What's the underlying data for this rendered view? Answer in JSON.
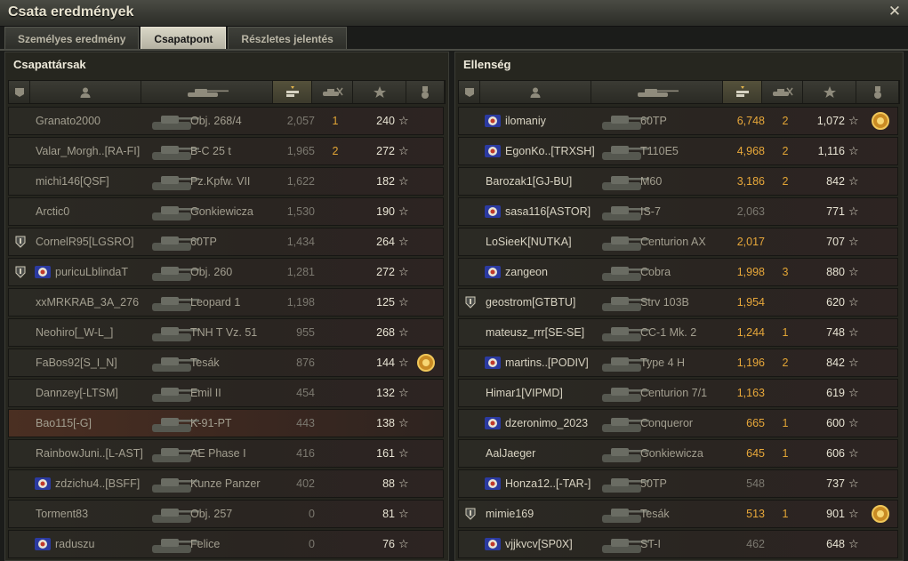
{
  "window": {
    "title": "Csata eredmények",
    "close_icon": "close-icon"
  },
  "tabs": [
    {
      "label": "Személyes eredmény",
      "active": false
    },
    {
      "label": "Csapatpont",
      "active": true
    },
    {
      "label": "Részletes jelentés",
      "active": false
    }
  ],
  "header_icons": [
    "badge-column-icon",
    "player-column-icon",
    "tank-column-icon",
    "damage-column-icon",
    "kills-column-icon",
    "xp-star-column-icon",
    "medal-column-icon"
  ],
  "colors": {
    "damage_accent": "#e8a83a",
    "kills_accent": "#e2a535",
    "highlight_row": "#4a2f22"
  },
  "allies": {
    "title": "Csapattársak",
    "rows": [
      {
        "badge": "",
        "icon": "",
        "player": "Granato2000",
        "tank": "Obj. 268/4",
        "damage": "2,057",
        "kills": "1",
        "xp": "240",
        "medal": "",
        "damage_high": false
      },
      {
        "badge": "",
        "icon": "",
        "player": "Valar_Morgh..[RA-FI]",
        "tank": "B-C 25 t",
        "damage": "1,965",
        "kills": "2",
        "xp": "272",
        "medal": "",
        "damage_high": false
      },
      {
        "badge": "",
        "icon": "",
        "player": "michi146[QSF]",
        "tank": "Pz.Kpfw. VII",
        "damage": "1,622",
        "kills": "",
        "xp": "182",
        "medal": "",
        "damage_high": false
      },
      {
        "badge": "",
        "icon": "",
        "player": "Arctic0",
        "tank": "Gonkiewicza",
        "damage": "1,530",
        "kills": "",
        "xp": "190",
        "medal": "",
        "damage_high": false
      },
      {
        "badge": "shield-badge-icon",
        "icon": "",
        "player": "CornelR95[LGSRO]",
        "tank": "60TP",
        "damage": "1,434",
        "kills": "",
        "xp": "264",
        "medal": "",
        "damage_high": false
      },
      {
        "badge": "shield-badge-icon",
        "icon": "clan-emblem-icon",
        "player": "puricuLblindaT",
        "tank": "Obj. 260",
        "damage": "1,281",
        "kills": "",
        "xp": "272",
        "medal": "",
        "damage_high": false
      },
      {
        "badge": "",
        "icon": "",
        "player": "xxMRKRAB_3A_276",
        "tank": "Leopard 1",
        "damage": "1,198",
        "kills": "",
        "xp": "125",
        "medal": "",
        "damage_high": false
      },
      {
        "badge": "",
        "icon": "",
        "player": "Neohiro[_W-L_]",
        "tank": "TNH T Vz. 51",
        "damage": "955",
        "kills": "",
        "xp": "268",
        "medal": "",
        "damage_high": false
      },
      {
        "badge": "",
        "icon": "",
        "player": "FaBos92[S_I_N]",
        "tank": "Tesák",
        "damage": "876",
        "kills": "",
        "xp": "144",
        "medal": "gold-medal-icon",
        "damage_high": false
      },
      {
        "badge": "",
        "icon": "",
        "player": "Dannzey[-LTSM]",
        "tank": "Emil II",
        "damage": "454",
        "kills": "",
        "xp": "132",
        "medal": "",
        "damage_high": false
      },
      {
        "badge": "",
        "icon": "",
        "player": "Bao115[-G]",
        "tank": "K-91-PT",
        "damage": "443",
        "kills": "",
        "xp": "138",
        "medal": "",
        "damage_high": false,
        "highlight": true
      },
      {
        "badge": "",
        "icon": "",
        "player": "RainbowJuni..[L-AST]",
        "tank": "AE Phase I",
        "damage": "416",
        "kills": "",
        "xp": "161",
        "medal": "",
        "damage_high": false
      },
      {
        "badge": "",
        "icon": "clan-emblem-icon",
        "player": "zdzichu4..[BSFF]",
        "tank": "Kunze Panzer",
        "damage": "402",
        "kills": "",
        "xp": "88",
        "medal": "",
        "damage_high": false
      },
      {
        "badge": "",
        "icon": "",
        "player": "Torment83",
        "tank": "Obj. 257",
        "damage": "0",
        "kills": "",
        "xp": "81",
        "medal": "",
        "damage_high": false
      },
      {
        "badge": "",
        "icon": "clan-emblem-icon",
        "player": "raduszu",
        "tank": "Felice",
        "damage": "0",
        "kills": "",
        "xp": "76",
        "medal": "",
        "damage_high": false
      }
    ]
  },
  "enemies": {
    "title": "Ellenség",
    "rows": [
      {
        "badge": "",
        "icon": "clan-emblem-icon",
        "player": "ilomaniy",
        "tank": "60TP",
        "damage": "6,748",
        "kills": "2",
        "xp": "1,072",
        "medal": "gold-medal-icon",
        "damage_high": true
      },
      {
        "badge": "",
        "icon": "clan-emblem-icon",
        "player": "EgonKo..[TRXSH]",
        "tank": "T110E5",
        "damage": "4,968",
        "kills": "2",
        "xp": "1,116",
        "medal": "",
        "damage_high": true
      },
      {
        "badge": "",
        "icon": "",
        "player": "Barozak1[GJ-BU]",
        "tank": "M60",
        "damage": "3,186",
        "kills": "2",
        "xp": "842",
        "medal": "",
        "damage_high": true
      },
      {
        "badge": "",
        "icon": "clan-emblem-icon",
        "player": "sasa116[ASTOR]",
        "tank": "IS-7",
        "damage": "2,063",
        "kills": "",
        "xp": "771",
        "medal": "",
        "damage_high": false
      },
      {
        "badge": "",
        "icon": "",
        "player": "LoSieeK[NUTKA]",
        "tank": "Centurion AX",
        "damage": "2,017",
        "kills": "",
        "xp": "707",
        "medal": "",
        "damage_high": true
      },
      {
        "badge": "",
        "icon": "clan-emblem-icon",
        "player": "zangeon",
        "tank": "Cobra",
        "damage": "1,998",
        "kills": "3",
        "xp": "880",
        "medal": "",
        "damage_high": true
      },
      {
        "badge": "shield-badge-icon",
        "icon": "",
        "player": "geostrom[GTBTU]",
        "tank": "Strv 103B",
        "damage": "1,954",
        "kills": "",
        "xp": "620",
        "medal": "",
        "damage_high": true
      },
      {
        "badge": "",
        "icon": "",
        "player": "mateusz_rrr[SE-SE]",
        "tank": "CC-1 Mk. 2",
        "damage": "1,244",
        "kills": "1",
        "xp": "748",
        "medal": "",
        "damage_high": true
      },
      {
        "badge": "",
        "icon": "clan-emblem-icon",
        "player": "martins..[PODIV]",
        "tank": "Type 4 H",
        "damage": "1,196",
        "kills": "2",
        "xp": "842",
        "medal": "",
        "damage_high": true
      },
      {
        "badge": "",
        "icon": "",
        "player": "Himar1[VIPMD]",
        "tank": "Centurion 7/1",
        "damage": "1,163",
        "kills": "",
        "xp": "619",
        "medal": "",
        "damage_high": true
      },
      {
        "badge": "",
        "icon": "clan-emblem-icon",
        "player": "dzeronimo_2023",
        "tank": "Conqueror",
        "damage": "665",
        "kills": "1",
        "xp": "600",
        "medal": "",
        "damage_high": true
      },
      {
        "badge": "",
        "icon": "",
        "player": "AalJaeger",
        "tank": "Gonkiewicza",
        "damage": "645",
        "kills": "1",
        "xp": "606",
        "medal": "",
        "damage_high": true
      },
      {
        "badge": "",
        "icon": "clan-emblem-icon",
        "player": "Honza12..[-TAR-]",
        "tank": "50TP",
        "damage": "548",
        "kills": "",
        "xp": "737",
        "medal": "",
        "damage_high": false
      },
      {
        "badge": "shield-badge-icon",
        "icon": "",
        "player": "mimie169",
        "tank": "Tesák",
        "damage": "513",
        "kills": "1",
        "xp": "901",
        "medal": "gold-medal-icon",
        "damage_high": true
      },
      {
        "badge": "",
        "icon": "clan-emblem-icon",
        "player": "vjjkvcv[SP0X]",
        "tank": "ST-I",
        "damage": "462",
        "kills": "",
        "xp": "648",
        "medal": "",
        "damage_high": false
      }
    ]
  }
}
